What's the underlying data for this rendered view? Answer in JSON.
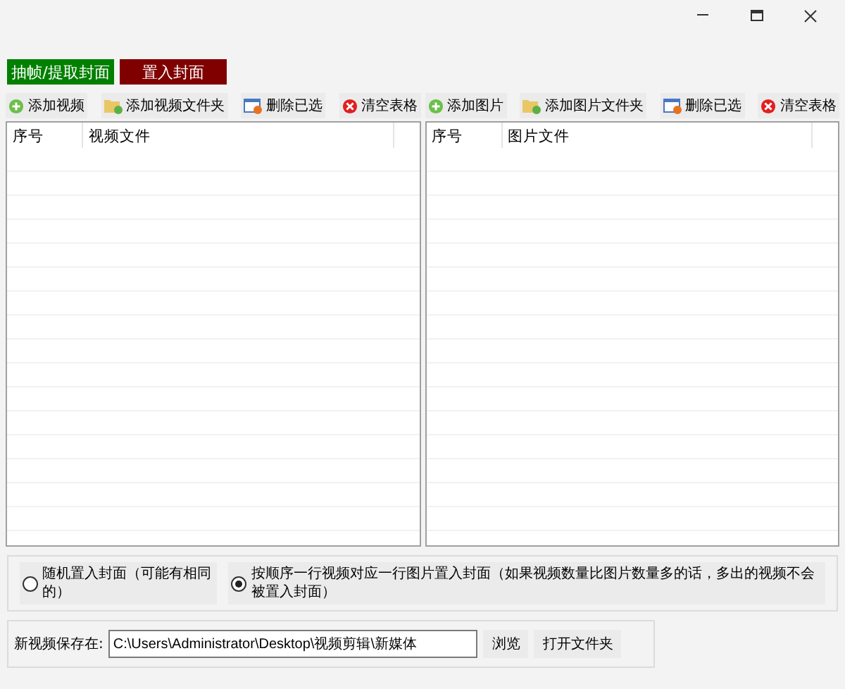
{
  "window_controls": [
    {
      "kind": "minimize"
    },
    {
      "kind": "maximize"
    },
    {
      "kind": "close"
    }
  ],
  "mode_buttons": [
    {
      "label": "抽帧/提取封面",
      "color": "#008000"
    },
    {
      "label": "置入封面",
      "color": "#800000"
    }
  ],
  "panels": [
    {
      "toolbar": [
        {
          "kind": "add",
          "label": "添加视频"
        },
        {
          "kind": "folder",
          "label": "添加视频文件夹"
        },
        {
          "kind": "delete",
          "label": "删除已选"
        },
        {
          "kind": "clear",
          "label": "清空表格"
        }
      ],
      "columns": [
        "序号",
        "视频文件"
      ]
    },
    {
      "toolbar": [
        {
          "kind": "add",
          "label": "添加图片"
        },
        {
          "kind": "folder",
          "label": "添加图片文件夹"
        },
        {
          "kind": "delete",
          "label": "删除已选"
        },
        {
          "kind": "clear",
          "label": "清空表格"
        }
      ],
      "columns": [
        "序号",
        "图片文件"
      ]
    }
  ],
  "options": [
    {
      "label": "随机置入封面（可能有相同的）",
      "selected": false
    },
    {
      "label": "按顺序一行视频对应一行图片置入封面（如果视频数量比图片数量多的话，多出的视频不会被置入封面）",
      "selected": true
    }
  ],
  "save": {
    "label": "新视频保存在:",
    "value": "C:\\Users\\Administrator\\Desktop\\视频剪辑\\新媒体",
    "buttons": [
      "浏览",
      "打开文件夹"
    ]
  }
}
